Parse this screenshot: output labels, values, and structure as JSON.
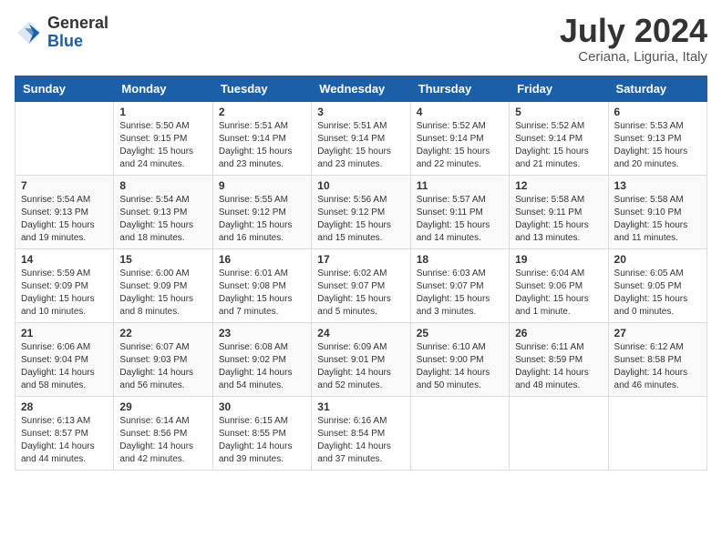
{
  "header": {
    "logo_general": "General",
    "logo_blue": "Blue",
    "month_title": "July 2024",
    "location": "Ceriana, Liguria, Italy"
  },
  "weekdays": [
    "Sunday",
    "Monday",
    "Tuesday",
    "Wednesday",
    "Thursday",
    "Friday",
    "Saturday"
  ],
  "weeks": [
    [
      {
        "day": "",
        "info": ""
      },
      {
        "day": "1",
        "info": "Sunrise: 5:50 AM\nSunset: 9:15 PM\nDaylight: 15 hours\nand 24 minutes."
      },
      {
        "day": "2",
        "info": "Sunrise: 5:51 AM\nSunset: 9:14 PM\nDaylight: 15 hours\nand 23 minutes."
      },
      {
        "day": "3",
        "info": "Sunrise: 5:51 AM\nSunset: 9:14 PM\nDaylight: 15 hours\nand 23 minutes."
      },
      {
        "day": "4",
        "info": "Sunrise: 5:52 AM\nSunset: 9:14 PM\nDaylight: 15 hours\nand 22 minutes."
      },
      {
        "day": "5",
        "info": "Sunrise: 5:52 AM\nSunset: 9:14 PM\nDaylight: 15 hours\nand 21 minutes."
      },
      {
        "day": "6",
        "info": "Sunrise: 5:53 AM\nSunset: 9:13 PM\nDaylight: 15 hours\nand 20 minutes."
      }
    ],
    [
      {
        "day": "7",
        "info": "Sunrise: 5:54 AM\nSunset: 9:13 PM\nDaylight: 15 hours\nand 19 minutes."
      },
      {
        "day": "8",
        "info": "Sunrise: 5:54 AM\nSunset: 9:13 PM\nDaylight: 15 hours\nand 18 minutes."
      },
      {
        "day": "9",
        "info": "Sunrise: 5:55 AM\nSunset: 9:12 PM\nDaylight: 15 hours\nand 16 minutes."
      },
      {
        "day": "10",
        "info": "Sunrise: 5:56 AM\nSunset: 9:12 PM\nDaylight: 15 hours\nand 15 minutes."
      },
      {
        "day": "11",
        "info": "Sunrise: 5:57 AM\nSunset: 9:11 PM\nDaylight: 15 hours\nand 14 minutes."
      },
      {
        "day": "12",
        "info": "Sunrise: 5:58 AM\nSunset: 9:11 PM\nDaylight: 15 hours\nand 13 minutes."
      },
      {
        "day": "13",
        "info": "Sunrise: 5:58 AM\nSunset: 9:10 PM\nDaylight: 15 hours\nand 11 minutes."
      }
    ],
    [
      {
        "day": "14",
        "info": "Sunrise: 5:59 AM\nSunset: 9:09 PM\nDaylight: 15 hours\nand 10 minutes."
      },
      {
        "day": "15",
        "info": "Sunrise: 6:00 AM\nSunset: 9:09 PM\nDaylight: 15 hours\nand 8 minutes."
      },
      {
        "day": "16",
        "info": "Sunrise: 6:01 AM\nSunset: 9:08 PM\nDaylight: 15 hours\nand 7 minutes."
      },
      {
        "day": "17",
        "info": "Sunrise: 6:02 AM\nSunset: 9:07 PM\nDaylight: 15 hours\nand 5 minutes."
      },
      {
        "day": "18",
        "info": "Sunrise: 6:03 AM\nSunset: 9:07 PM\nDaylight: 15 hours\nand 3 minutes."
      },
      {
        "day": "19",
        "info": "Sunrise: 6:04 AM\nSunset: 9:06 PM\nDaylight: 15 hours\nand 1 minute."
      },
      {
        "day": "20",
        "info": "Sunrise: 6:05 AM\nSunset: 9:05 PM\nDaylight: 15 hours\nand 0 minutes."
      }
    ],
    [
      {
        "day": "21",
        "info": "Sunrise: 6:06 AM\nSunset: 9:04 PM\nDaylight: 14 hours\nand 58 minutes."
      },
      {
        "day": "22",
        "info": "Sunrise: 6:07 AM\nSunset: 9:03 PM\nDaylight: 14 hours\nand 56 minutes."
      },
      {
        "day": "23",
        "info": "Sunrise: 6:08 AM\nSunset: 9:02 PM\nDaylight: 14 hours\nand 54 minutes."
      },
      {
        "day": "24",
        "info": "Sunrise: 6:09 AM\nSunset: 9:01 PM\nDaylight: 14 hours\nand 52 minutes."
      },
      {
        "day": "25",
        "info": "Sunrise: 6:10 AM\nSunset: 9:00 PM\nDaylight: 14 hours\nand 50 minutes."
      },
      {
        "day": "26",
        "info": "Sunrise: 6:11 AM\nSunset: 8:59 PM\nDaylight: 14 hours\nand 48 minutes."
      },
      {
        "day": "27",
        "info": "Sunrise: 6:12 AM\nSunset: 8:58 PM\nDaylight: 14 hours\nand 46 minutes."
      }
    ],
    [
      {
        "day": "28",
        "info": "Sunrise: 6:13 AM\nSunset: 8:57 PM\nDaylight: 14 hours\nand 44 minutes."
      },
      {
        "day": "29",
        "info": "Sunrise: 6:14 AM\nSunset: 8:56 PM\nDaylight: 14 hours\nand 42 minutes."
      },
      {
        "day": "30",
        "info": "Sunrise: 6:15 AM\nSunset: 8:55 PM\nDaylight: 14 hours\nand 39 minutes."
      },
      {
        "day": "31",
        "info": "Sunrise: 6:16 AM\nSunset: 8:54 PM\nDaylight: 14 hours\nand 37 minutes."
      },
      {
        "day": "",
        "info": ""
      },
      {
        "day": "",
        "info": ""
      },
      {
        "day": "",
        "info": ""
      }
    ]
  ]
}
